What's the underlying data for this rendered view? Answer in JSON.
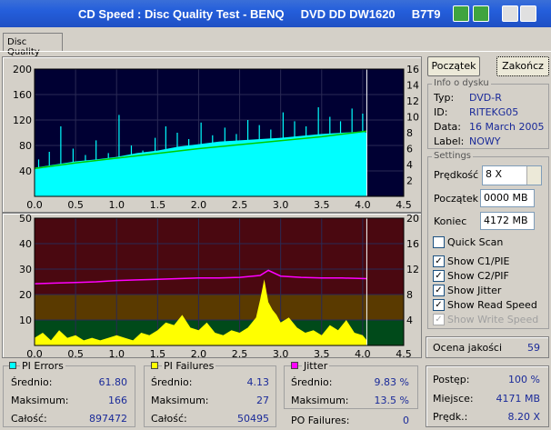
{
  "window": {
    "title": "CD Speed : Disc Quality Test - BENQ     DVD DD DW1620     B7T9"
  },
  "tab": {
    "label": "Disc Quality"
  },
  "buttons": {
    "start": "Początek",
    "stop": "Zakończ"
  },
  "disc_info": {
    "group_title": "Info o dysku",
    "rows": [
      {
        "label": "Typ:",
        "value": "DVD-R"
      },
      {
        "label": "ID:",
        "value": "RITEKG05"
      },
      {
        "label": "Data:",
        "value": "16 March 2005"
      },
      {
        "label": "Label:",
        "value": "NOWY"
      }
    ]
  },
  "settings": {
    "group_title": "Settings",
    "speed_label": "Prędkość",
    "speed_value": "8 X",
    "start_label": "Początek",
    "start_value": "0000 MB",
    "end_label": "Koniec",
    "end_value": "4172 MB",
    "checkboxes": [
      {
        "label": "Quick Scan",
        "checked": false,
        "disabled": false
      },
      {
        "label": "Show C1/PIE",
        "checked": true,
        "disabled": false
      },
      {
        "label": "Show C2/PIF",
        "checked": true,
        "disabled": false
      },
      {
        "label": "Show Jitter",
        "checked": true,
        "disabled": false
      },
      {
        "label": "Show Read Speed",
        "checked": true,
        "disabled": false
      },
      {
        "label": "Show Write Speed",
        "checked": true,
        "disabled": true
      }
    ]
  },
  "quality": {
    "label": "Ocena jakości",
    "value": "59"
  },
  "progress": {
    "rows": [
      {
        "label": "Postęp:",
        "value": "100 %"
      },
      {
        "label": "Miejsce:",
        "value": "4171 MB"
      },
      {
        "label": "Prędk.:",
        "value": "8.20 X"
      }
    ]
  },
  "pi_errors": {
    "title": "PI Errors",
    "color": "#00ffff",
    "rows": [
      {
        "label": "Średnio:",
        "value": "61.80"
      },
      {
        "label": "Maksimum:",
        "value": "166"
      },
      {
        "label": "Całość:",
        "value": "897472"
      }
    ]
  },
  "pi_failures": {
    "title": "PI Failures",
    "color": "#ffff00",
    "rows": [
      {
        "label": "Średnio:",
        "value": "4.13"
      },
      {
        "label": "Maksimum:",
        "value": "27"
      },
      {
        "label": "Całość:",
        "value": "50495"
      }
    ]
  },
  "jitter": {
    "title": "Jitter",
    "color": "#ff00ff",
    "rows": [
      {
        "label": "Średnio:",
        "value": "9.83 %"
      },
      {
        "label": "Maksimum:",
        "value": "13.5 %"
      }
    ],
    "po_label": "PO Failures:",
    "po_value": "0"
  },
  "chart_data": [
    {
      "type": "area",
      "x_ticks": [
        "0.0",
        "0.5",
        "1.0",
        "1.5",
        "2.0",
        "2.5",
        "3.0",
        "3.5",
        "4.0",
        "4.5"
      ],
      "y_left_ticks": [
        "200",
        "160",
        "120",
        "80",
        "40"
      ],
      "y_right_ticks": [
        "16",
        "14",
        "12",
        "10",
        "8",
        "6",
        "4",
        "2"
      ],
      "xlim": [
        0,
        4.5
      ],
      "ylim": [
        0,
        200
      ],
      "y2lim": [
        0,
        16
      ],
      "background": "#000033",
      "series": [
        {
          "color": "#00ffff",
          "x": [
            0.0,
            0.25,
            0.5,
            0.75,
            1.0,
            1.25,
            1.5,
            1.75,
            2.0,
            2.25,
            2.5,
            2.75,
            3.0,
            3.25,
            3.5,
            3.75,
            4.0,
            4.05
          ],
          "values": [
            45,
            50,
            55,
            58,
            62,
            68,
            72,
            78,
            82,
            86,
            88,
            90,
            92,
            95,
            98,
            100,
            102,
            100
          ]
        },
        {
          "color": "#00cc00",
          "x": [
            0.0,
            0.5,
            1.0,
            1.5,
            2.0,
            2.5,
            3.0,
            3.5,
            4.05
          ],
          "values": [
            3.5,
            4.2,
            4.8,
            5.4,
            6.0,
            6.5,
            7.0,
            7.5,
            8.2
          ]
        }
      ],
      "spikes": {
        "color": "#00ffff",
        "x": [
          0.05,
          0.18,
          0.32,
          0.47,
          0.62,
          0.75,
          0.9,
          1.03,
          1.18,
          1.32,
          1.47,
          1.6,
          1.74,
          1.88,
          2.03,
          2.17,
          2.32,
          2.46,
          2.6,
          2.74,
          2.88,
          3.03,
          3.17,
          3.31,
          3.46,
          3.6,
          3.73,
          3.87,
          4.0
        ],
        "values": [
          58,
          70,
          110,
          75,
          65,
          88,
          68,
          128,
          80,
          72,
          92,
          110,
          100,
          90,
          116,
          96,
          108,
          98,
          120,
          112,
          105,
          132,
          118,
          110,
          140,
          125,
          118,
          138,
          130
        ]
      }
    },
    {
      "type": "area",
      "x_ticks": [
        "0.0",
        "0.5",
        "1.0",
        "1.5",
        "2.0",
        "2.5",
        "3.0",
        "3.5",
        "4.0",
        "4.5"
      ],
      "y_left_ticks": [
        "50",
        "40",
        "30",
        "20",
        "10"
      ],
      "y_right_ticks": [
        "20",
        "16",
        "12",
        "8",
        "4"
      ],
      "xlim": [
        0,
        4.5
      ],
      "ylim": [
        0,
        50
      ],
      "y2lim": [
        0,
        20
      ],
      "bands": [
        {
          "from": 0,
          "to": 4,
          "color": "#004a1a"
        },
        {
          "from": 4,
          "to": 8,
          "color": "#5a3a00"
        },
        {
          "from": 8,
          "to": 20,
          "color": "#4a0810"
        }
      ],
      "series": [
        {
          "color": "#ffff00",
          "x": [
            0.0,
            0.1,
            0.2,
            0.3,
            0.4,
            0.5,
            0.6,
            0.7,
            0.8,
            0.9,
            1.0,
            1.1,
            1.2,
            1.3,
            1.4,
            1.5,
            1.6,
            1.7,
            1.8,
            1.9,
            2.0,
            2.1,
            2.2,
            2.3,
            2.4,
            2.5,
            2.6,
            2.7,
            2.75,
            2.8,
            2.85,
            2.9,
            2.95,
            3.0,
            3.1,
            3.2,
            3.3,
            3.4,
            3.5,
            3.6,
            3.7,
            3.8,
            3.9,
            4.0,
            4.05
          ],
          "values": [
            3,
            5,
            2,
            6,
            3,
            4,
            2,
            3,
            2,
            3,
            4,
            3,
            2,
            5,
            4,
            6,
            9,
            8,
            12,
            7,
            6,
            9,
            5,
            4,
            6,
            5,
            7,
            11,
            18,
            26,
            17,
            14,
            12,
            9,
            11,
            7,
            5,
            6,
            4,
            8,
            6,
            10,
            5,
            4,
            2
          ]
        },
        {
          "color": "#ff00ff",
          "x": [
            0.0,
            0.25,
            0.5,
            0.75,
            1.0,
            1.25,
            1.5,
            1.75,
            2.0,
            2.25,
            2.5,
            2.75,
            2.85,
            3.0,
            3.25,
            3.5,
            3.75,
            4.05
          ],
          "values": [
            9.7,
            9.8,
            9.9,
            10.0,
            10.2,
            10.3,
            10.4,
            10.5,
            10.6,
            10.6,
            10.7,
            11.0,
            11.8,
            10.9,
            10.7,
            10.6,
            10.6,
            10.5
          ]
        }
      ]
    }
  ]
}
